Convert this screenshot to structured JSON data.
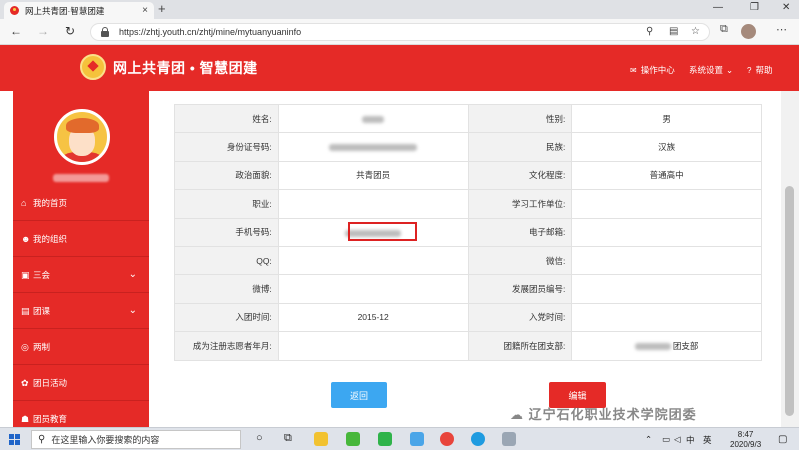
{
  "browser": {
    "tab_title": "网上共青团·智慧团建",
    "tab_close": "×",
    "new_tab": "+",
    "url": "https://zhtj.youth.cn/zhtj/mine/mytuanyuaninfo",
    "back": "←",
    "forward": "→",
    "refresh": "↻",
    "home": "⌂",
    "window_min": "—",
    "window_max": "❐",
    "window_close": "✕"
  },
  "site": {
    "title": "网上共青团 • 智慧团建",
    "nav": {
      "operation_center": "操作中心",
      "system_settings": "系统设置",
      "help": "帮助"
    }
  },
  "sidebar": {
    "items": [
      {
        "label": "我的首页",
        "icon": "home-icon",
        "has_chevron": false
      },
      {
        "label": "我的组织",
        "icon": "group-icon",
        "has_chevron": false
      },
      {
        "label": "三会",
        "icon": "meeting-icon",
        "has_chevron": true
      },
      {
        "label": "团课",
        "icon": "course-icon",
        "has_chevron": true
      },
      {
        "label": "两制",
        "icon": "system-icon",
        "has_chevron": false
      },
      {
        "label": "团日活动",
        "icon": "activity-icon",
        "has_chevron": false
      },
      {
        "label": "团员教育",
        "icon": "education-icon",
        "has_chevron": false
      }
    ]
  },
  "profile": {
    "rows": [
      {
        "l1": "姓名:",
        "v1": "",
        "l2": "性别:",
        "v2": "男"
      },
      {
        "l1": "身份证号码:",
        "v1": "",
        "l2": "民族:",
        "v2": "汉族"
      },
      {
        "l1": "政治面貌:",
        "v1": "共青团员",
        "l2": "文化程度:",
        "v2": "普通高中"
      },
      {
        "l1": "职业:",
        "v1": "",
        "l2": "学习工作单位:",
        "v2": ""
      },
      {
        "l1": "手机号码:",
        "v1": "",
        "l2": "电子邮箱:",
        "v2": ""
      },
      {
        "l1": "QQ:",
        "v1": "",
        "l2": "微信:",
        "v2": ""
      },
      {
        "l1": "微博:",
        "v1": "",
        "l2": "发展团员编号:",
        "v2": ""
      },
      {
        "l1": "入团时间:",
        "v1": "2015-12",
        "l2": "入党时间:",
        "v2": ""
      },
      {
        "l1": "成为注册志愿者年月:",
        "v1": "",
        "l2": "团籍所在团支部:",
        "v2": "团支部"
      }
    ]
  },
  "actions": {
    "back": "返回",
    "edit": "编辑"
  },
  "watermark": "辽宁石化职业技术学院团委",
  "taskbar": {
    "search_placeholder": "在这里输入你要搜索的内容",
    "time": "8:47",
    "date": "2020/9/3",
    "ime": "中",
    "lang": "英"
  },
  "colors": {
    "brand_red": "#e52a27",
    "button_blue": "#3ca7f1"
  }
}
